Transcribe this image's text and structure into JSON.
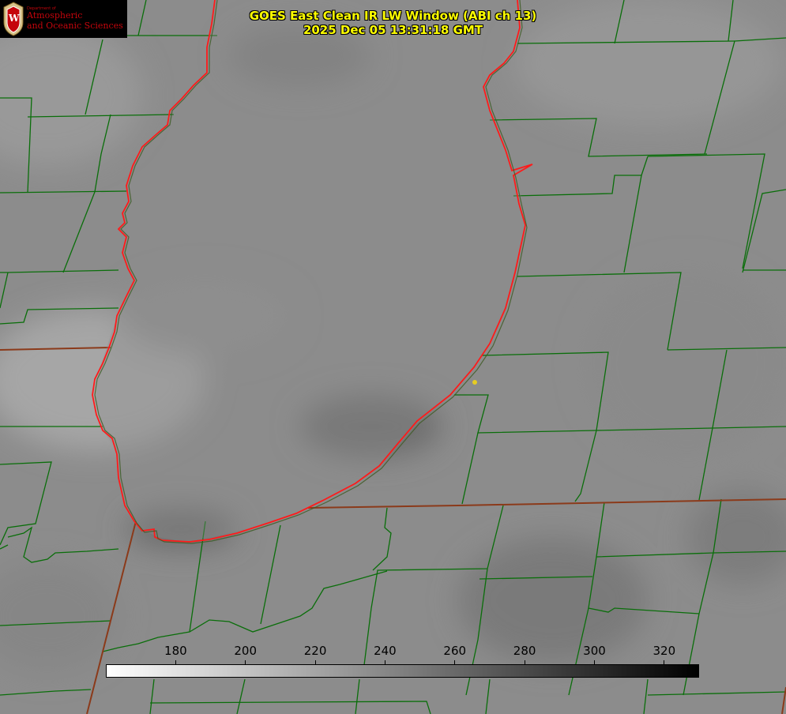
{
  "header": {
    "title_line1": "GOES East Clean IR LW Window (ABI ch 13)",
    "title_line2": "2025 Dec 05 13:31:18 GMT"
  },
  "logo": {
    "department": "Department of",
    "line1": "Atmospheric",
    "line2": "and Oceanic Sciences",
    "badge_letter": "W",
    "color": "#c5050c"
  },
  "colorbar": {
    "min": 160,
    "max": 330,
    "ticks": [
      180,
      200,
      220,
      240,
      260,
      280,
      300,
      320
    ],
    "gradient": [
      "#ffffff",
      "#000000"
    ]
  },
  "colors": {
    "coastline": "#ff1a1a",
    "county_lines": "#0a6e0a",
    "state_lines": "#8b3a1a",
    "marker": "#e6cc22",
    "title_text": "#ffff00"
  }
}
